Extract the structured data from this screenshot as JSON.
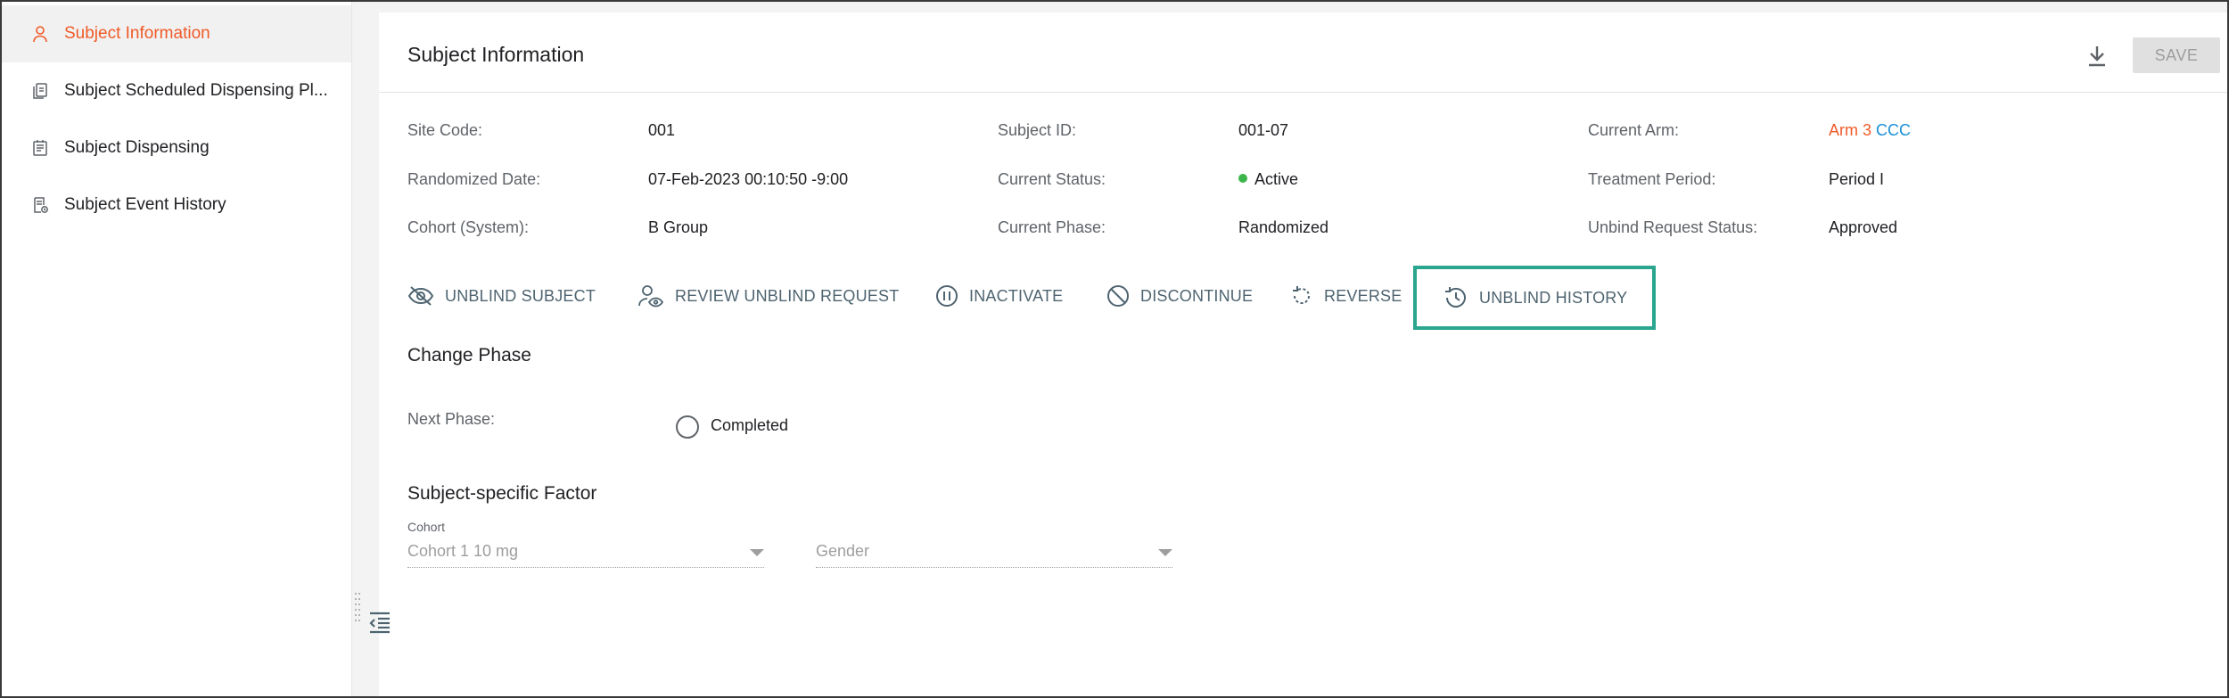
{
  "sidebar": {
    "items": [
      {
        "label": "Subject Information",
        "icon": "user-icon",
        "active": true
      },
      {
        "label": "Subject Scheduled Dispensing Pl...",
        "icon": "document-copy-icon",
        "active": false
      },
      {
        "label": "Subject Dispensing",
        "icon": "dispensing-icon",
        "active": false
      },
      {
        "label": "Subject Event History",
        "icon": "history-document-icon",
        "active": false
      }
    ]
  },
  "header": {
    "title": "Subject Information",
    "download_icon": "download-icon",
    "save_label": "SAVE"
  },
  "info": {
    "site_code_label": "Site Code:",
    "site_code": "001",
    "randomized_date_label": "Randomized Date:",
    "randomized_date": "07-Feb-2023 00:10:50 -9:00",
    "cohort_system_label": "Cohort (System):",
    "cohort_system": "B Group",
    "subject_id_label": "Subject ID:",
    "subject_id": "001-07",
    "current_status_label": "Current Status:",
    "current_status": "Active",
    "current_phase_label": "Current Phase:",
    "current_phase": "Randomized",
    "current_arm_label": "Current Arm:",
    "current_arm_part1": "Arm 3",
    "current_arm_part2": "CCC",
    "treatment_period_label": "Treatment Period:",
    "treatment_period": "Period I",
    "unbind_request_status_label": "Unbind Request Status:",
    "unbind_request_status": "Approved"
  },
  "actions": {
    "unblind_subject": "UNBLIND SUBJECT",
    "review_unblind_request": "REVIEW UNBLIND REQUEST",
    "inactivate": "INACTIVATE",
    "discontinue": "DISCONTINUE",
    "reverse": "REVERSE",
    "unblind_history": "UNBLIND HISTORY"
  },
  "change_phase": {
    "title": "Change Phase",
    "next_phase_label": "Next Phase:",
    "option_completed": "Completed"
  },
  "factor": {
    "title": "Subject-specific Factor",
    "cohort_caption": "Cohort",
    "cohort_value": "Cohort 1 10 mg",
    "gender_value": "Gender"
  },
  "colors": {
    "accent": "#f05a28",
    "link_blue": "#1a8fd6",
    "active_green": "#3cb54a",
    "highlight_teal": "#2aa58e",
    "action_text": "#4e6470"
  }
}
